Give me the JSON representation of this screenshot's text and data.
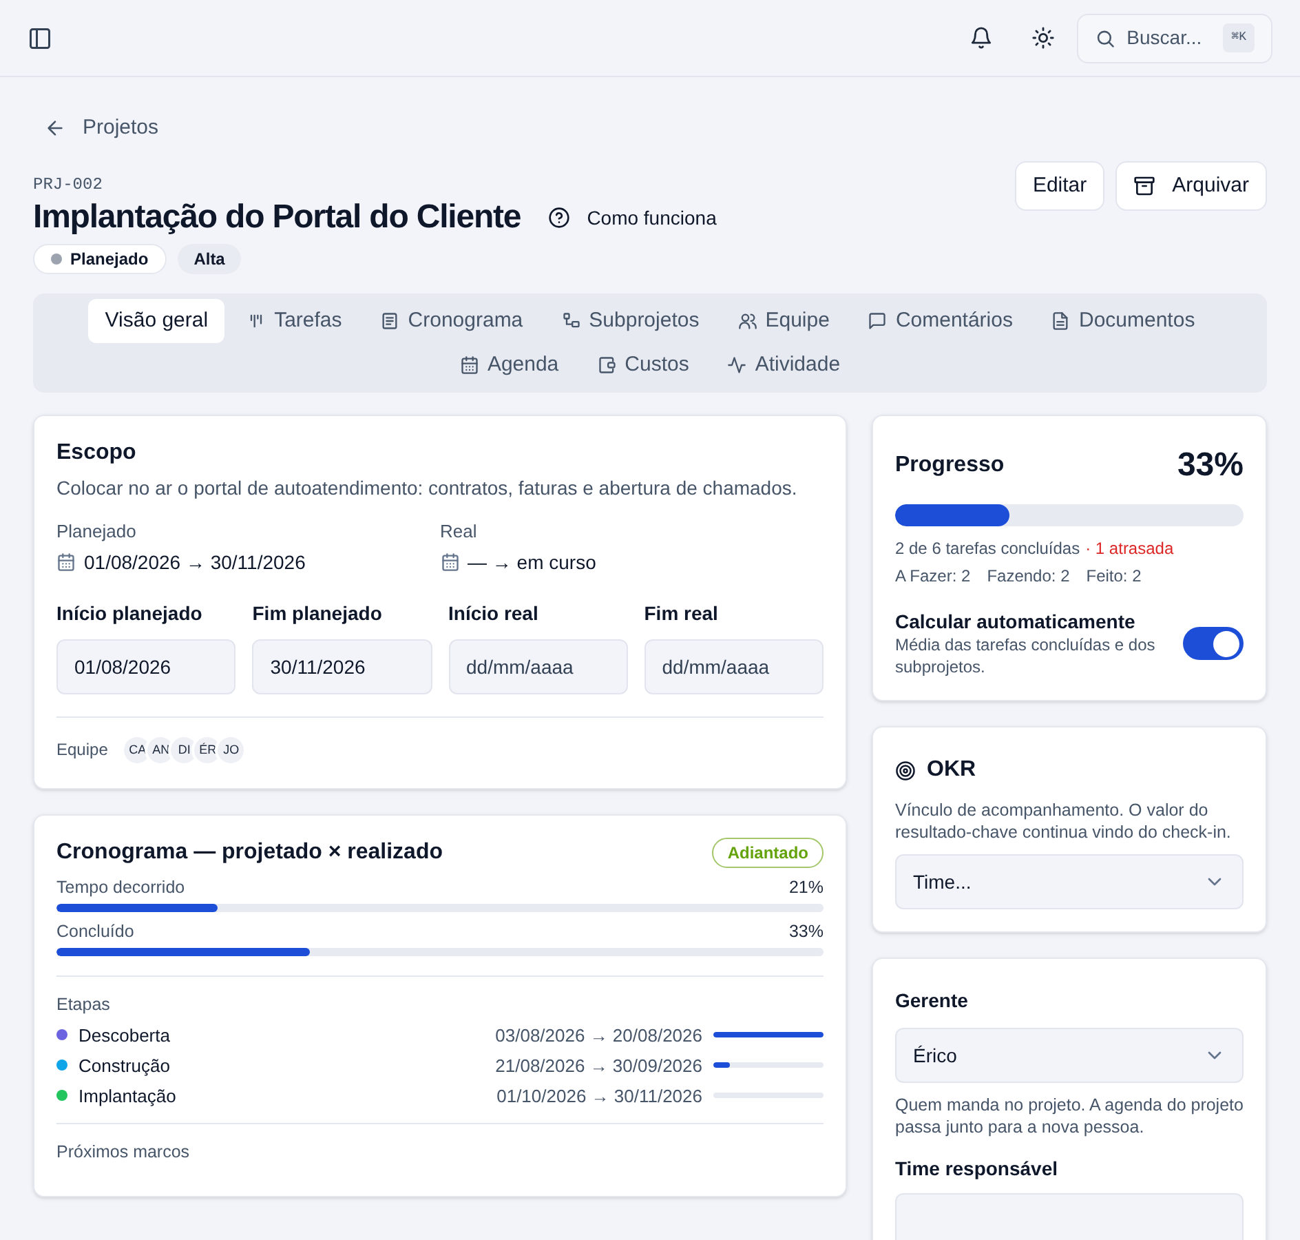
{
  "topbar": {
    "search": {
      "placeholder": "Buscar...",
      "shortcut": "⌘K"
    }
  },
  "breadcrumb": {
    "back_label": "Projetos"
  },
  "project": {
    "code": "PRJ-002",
    "title": "Implantação do Portal do Cliente",
    "help_link": "Como funciona",
    "badges": [
      {
        "label": "Planejado",
        "color": "#9ca3af"
      },
      {
        "label": "Alta"
      }
    ]
  },
  "actions": [
    {
      "label": "Editar",
      "kind": "plain"
    },
    {
      "label": "Arquivar",
      "kind": "archive"
    }
  ],
  "tabs": [
    {
      "label": "Visão geral",
      "selected": true
    },
    {
      "label": "Tarefas",
      "selected": false
    },
    {
      "label": "Cronograma",
      "selected": false
    },
    {
      "label": "Subprojetos",
      "selected": false
    },
    {
      "label": "Equipe",
      "selected": false
    },
    {
      "label": "Comentários",
      "selected": false
    },
    {
      "label": "Documentos",
      "selected": false
    },
    {
      "label": "Agenda",
      "selected": false
    },
    {
      "label": "Custos",
      "selected": false
    },
    {
      "label": "Atividade",
      "selected": false
    }
  ],
  "scope": {
    "title": "Escopo",
    "description": "Colocar no ar o portal de autoatendimento: contratos, faturas e abertura de chamados.",
    "periods": [
      {
        "label": "Planejado",
        "value": "01/08/2026 → 30/11/2026"
      },
      {
        "label": "Real",
        "value": "— → em curso"
      }
    ],
    "date_fields": [
      {
        "label": "Início planejado",
        "value": "01/08/2026"
      },
      {
        "label": "Fim planejado",
        "value": "30/11/2026"
      },
      {
        "label": "Início real",
        "placeholder": "dd/mm/aaaa"
      },
      {
        "label": "Fim real",
        "placeholder": "dd/mm/aaaa"
      }
    ],
    "team_label": "Equipe",
    "team": [
      "CA",
      "AN",
      "DI",
      "ÉR",
      "JO"
    ]
  },
  "schedule": {
    "title": "Cronograma — projetado × realizado",
    "status": "Adiantado",
    "meters": [
      {
        "label": "Tempo decorrido",
        "reading": "21%",
        "level": 0.21
      },
      {
        "label": "Concluído",
        "reading": "33%",
        "level": 0.33
      }
    ],
    "stages_label": "Etapas",
    "stages": [
      {
        "name": "Descoberta",
        "color": "#6c63e0",
        "dates": "03/08/2026 → 20/08/2026",
        "level": 1
      },
      {
        "name": "Construção",
        "color": "#0ea5e9",
        "dates": "21/08/2026 → 30/09/2026",
        "level": 0.15
      },
      {
        "name": "Implantação",
        "color": "#22c55e",
        "dates": "01/10/2026 → 30/11/2026",
        "level": 0
      }
    ],
    "milestones_label": "Próximos marcos"
  },
  "progress": {
    "title": "Progresso",
    "value": "33%",
    "level": 0.33,
    "summary": "2 de 6 tarefas concluídas",
    "overdue": "· 1 atrasada",
    "counts": [
      {
        "label": "A Fazer:",
        "value": "2"
      },
      {
        "label": "Fazendo:",
        "value": "2"
      },
      {
        "label": "Feito:",
        "value": "2"
      }
    ],
    "auto": {
      "title": "Calcular automaticamente",
      "description": "Média das tarefas concluídas e dos subprojetos.",
      "on": true
    }
  },
  "okr": {
    "title": "OKR",
    "description": "Vínculo de acompanhamento. O valor do resultado-chave continua vindo do check-in.",
    "select": "Time..."
  },
  "owner": {
    "manager_label": "Gerente",
    "manager": "Érico",
    "manager_help": "Quem manda no projeto. A agenda do projeto passa junto para a nova pessoa.",
    "team_label": "Time responsável"
  }
}
